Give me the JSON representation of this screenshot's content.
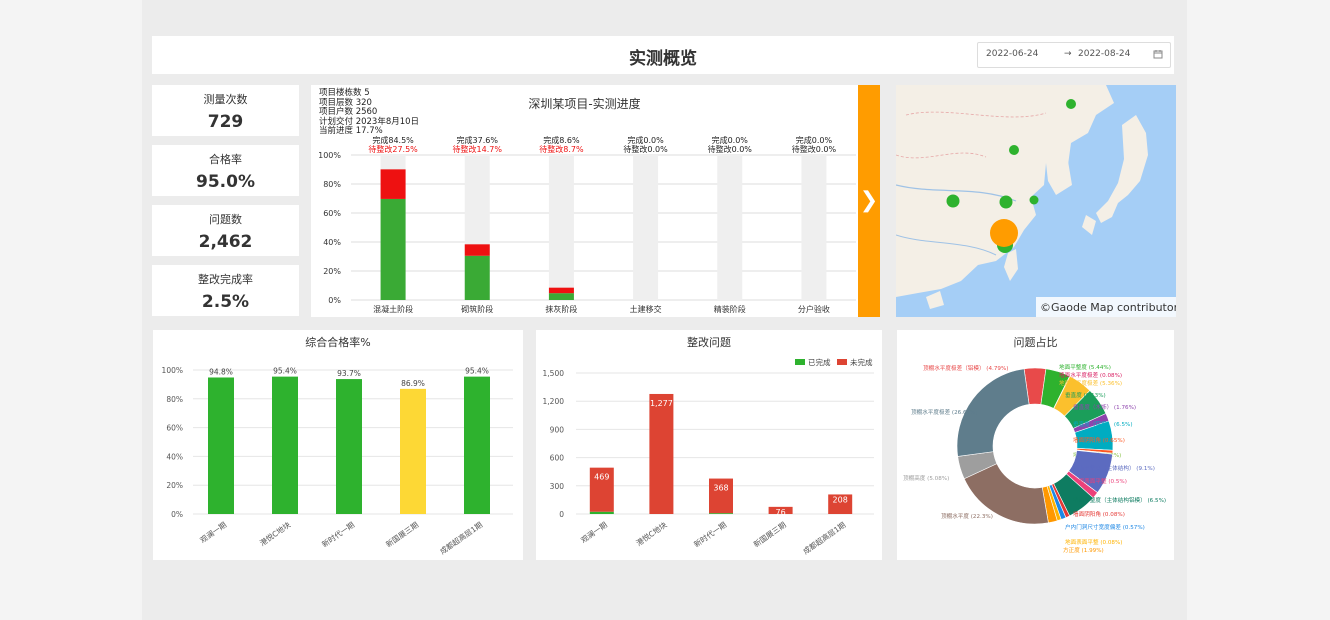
{
  "header": {
    "title": "实测概览",
    "date_start": "2022-06-24",
    "date_arrow": "→",
    "date_end": "2022-08-24"
  },
  "kpis": [
    {
      "label": "测量次数",
      "value": "729"
    },
    {
      "label": "合格率",
      "value": "95.0%"
    },
    {
      "label": "问题数",
      "value": "2,462"
    },
    {
      "label": "整改完成率",
      "value": "2.5%"
    }
  ],
  "project": {
    "info": [
      "项目楼栋数 5",
      "项目层数 320",
      "项目户数 2560",
      "计划交付 2023年8月10日",
      "当前进度 17.7%"
    ]
  },
  "map": {
    "attribution": "©Gaode Map contributors"
  },
  "expand_icon": "chevron-right-icon",
  "colors": {
    "green": "#3aaa35",
    "red": "#ee1111",
    "yellow": "#fdd835",
    "orange": "#ff9c00",
    "bar_green": "#2eb22e",
    "bar_red": "#dd4433"
  },
  "chart_data": [
    {
      "type": "bar",
      "title": "深圳某项目-实测进度",
      "categories": [
        "混凝土阶段",
        "砌筑阶段",
        "抹灰阶段",
        "土建移交",
        "精装阶段",
        "分户验收"
      ],
      "ylim": [
        0,
        100
      ],
      "yticks": [
        "100%",
        "80%",
        "60%",
        "40%",
        "20%",
        "0%"
      ],
      "series": [
        {
          "name": "完成",
          "values": [
            69.7,
            30.5,
            4.7,
            0,
            0,
            0
          ]
        },
        {
          "name": "待整改",
          "values": [
            20.4,
            7.9,
            3.8,
            0,
            0,
            0
          ]
        }
      ],
      "top_labels": [
        "完成84.5%",
        "完成37.6%",
        "完成8.6%",
        "完成0.0%",
        "完成0.0%",
        "完成0.0%"
      ],
      "sub_labels": [
        "待整改27.5%",
        "待整改14.7%",
        "待整改8.7%",
        "待整改0.0%",
        "待整改0.0%",
        "待整改0.0%"
      ]
    },
    {
      "type": "bar",
      "title": "综合合格率%",
      "categories": [
        "观澜一期",
        "港悦C地块",
        "新时代一期",
        "新国展三期",
        "成都超高层1期"
      ],
      "values": [
        94.8,
        95.4,
        93.7,
        86.9,
        95.4
      ],
      "labels": [
        "94.8%",
        "95.4%",
        "93.7%",
        "86.9%",
        "95.4%"
      ],
      "ylim": [
        0,
        100
      ],
      "yticks": [
        "100%",
        "80%",
        "60%",
        "40%",
        "20%",
        "0%"
      ]
    },
    {
      "type": "bar",
      "title": "整改问题",
      "categories": [
        "观澜一期",
        "港悦C地块",
        "新时代一期",
        "新国展三期",
        "成都超高层1期"
      ],
      "series": [
        {
          "name": "已完成",
          "values": [
            24,
            0,
            9,
            0,
            0
          ]
        },
        {
          "name": "未完成",
          "values": [
            469,
            1277,
            368,
            76,
            208
          ]
        }
      ],
      "labels": [
        "469",
        "1,277",
        "368",
        "76",
        "208"
      ],
      "ylim": [
        0,
        1500
      ],
      "yticks": [
        "1,500",
        "1,200",
        "900",
        "600",
        "300",
        "0"
      ]
    },
    {
      "type": "pie",
      "title": "问题占比",
      "slices": [
        {
          "label": "顶棚水平度极差（铝模） (4.79%)",
          "value": 4.79,
          "color": "#e84a4a"
        },
        {
          "label": "地面平整度 (5.44%)",
          "value": 5.44,
          "color": "#2eb22e"
        },
        {
          "label": "墙面水平度极差 (0.08%)",
          "value": 0.08,
          "color": "#d81b60"
        },
        {
          "label": "地面水平度极差 (5.36%)",
          "value": 5.36,
          "color": "#fbc02d"
        },
        {
          "label": "垂直度 (6.13%)",
          "value": 6.13,
          "color": "#1b9e5a"
        },
        {
          "label": "垂直度（木饰） (1.76%)",
          "value": 1.76,
          "color": "#8e44ad"
        },
        {
          "label": "垂直度（铝模） (6.5%)",
          "value": 6.5,
          "color": "#00acc1"
        },
        {
          "label": "墙面阴阳角 (0.65%)",
          "value": 0.65,
          "color": "#ff5722"
        },
        {
          "label": "墙面平整度 (0.2%)",
          "value": 0.2,
          "color": "#8bc34a"
        },
        {
          "label": "墙面平整度（主体结构） (9.1%)",
          "value": 9.1,
          "color": "#5c6bc0"
        },
        {
          "label": "墙面表面平整 (0.5%)",
          "value": 1.5,
          "color": "#ec407a"
        },
        {
          "label": "墙面平整度（主体结构铝模） (6.5%)",
          "value": 6.5,
          "color": "#0e7c61"
        },
        {
          "label": "墙面阴阳角 (0.08%)",
          "value": 0.9,
          "color": "#e53935"
        },
        {
          "label": "户内门洞尺寸宽度偏差 (0.57%)",
          "value": 1.1,
          "color": "#1e88e5"
        },
        {
          "label": "地面表面平整 (0.08%)",
          "value": 0.9,
          "color": "#ffb300"
        },
        {
          "label": "方正度 (1.99%)",
          "value": 1.99,
          "color": "#ff9800"
        },
        {
          "label": "顶棚水平度 (22.3%)",
          "value": 22.3,
          "color": "#8d6e63"
        },
        {
          "label": "顶棚高度 (5.08%)",
          "value": 5.08,
          "color": "#9e9e9e"
        },
        {
          "label": "顶棚水平度极差 (26.61%)",
          "value": 26.61,
          "color": "#5f7d8c"
        }
      ]
    }
  ]
}
